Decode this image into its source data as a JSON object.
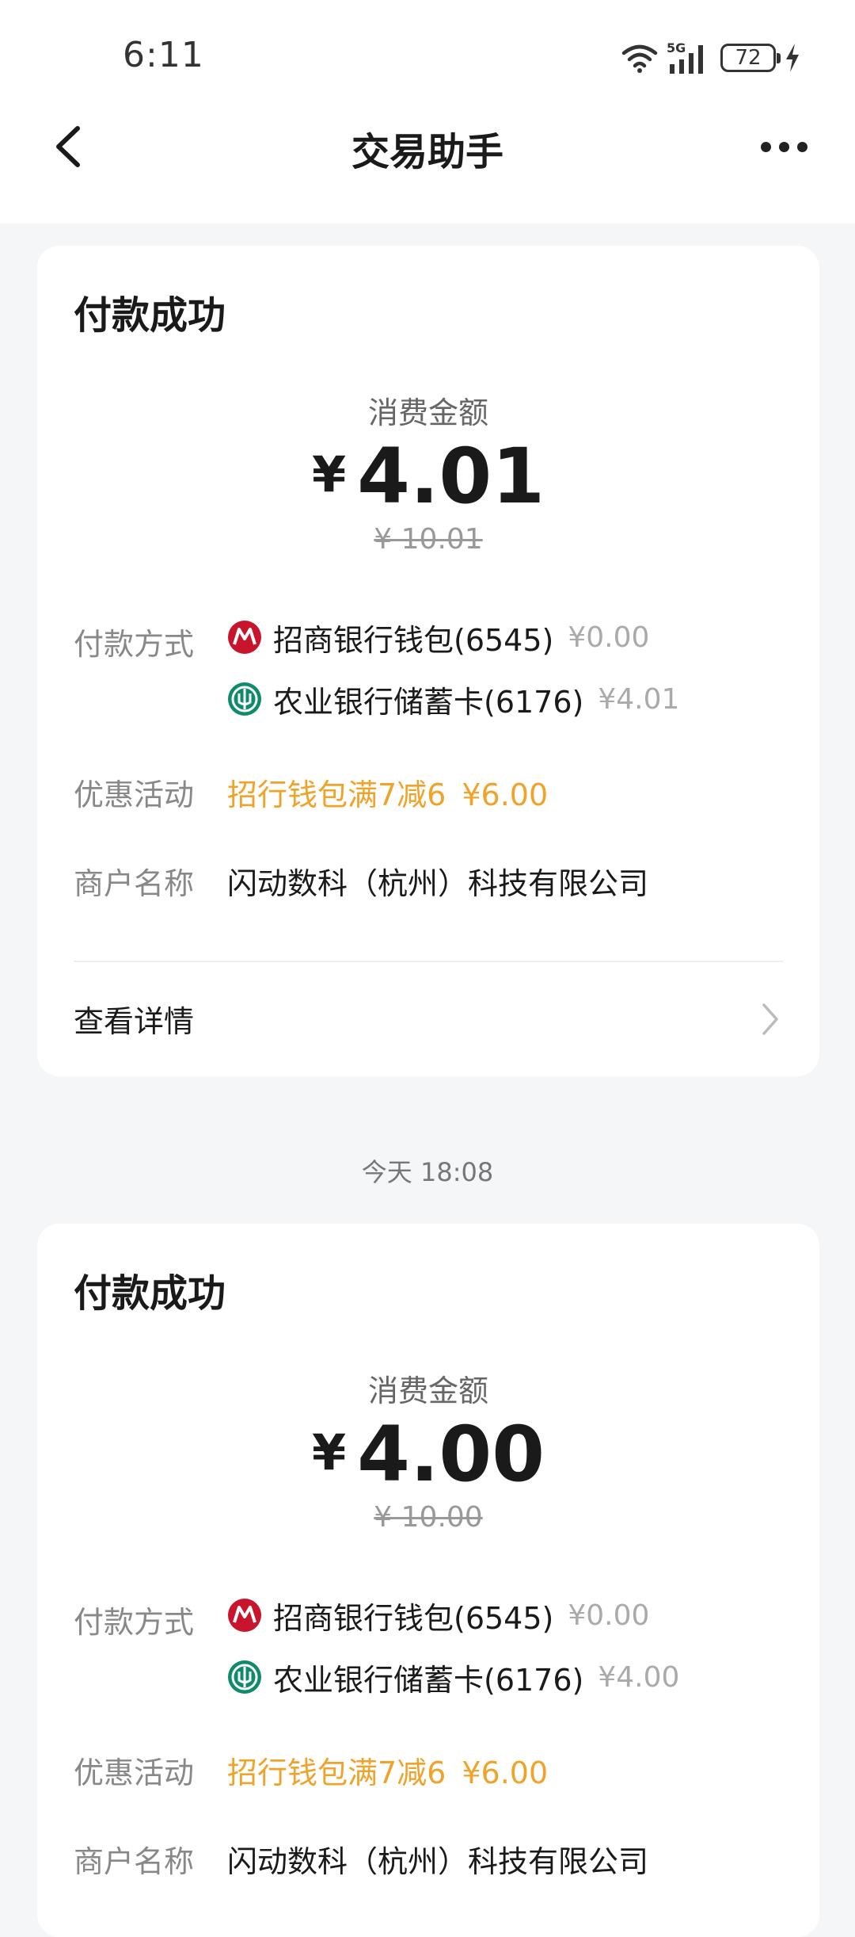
{
  "status_bar": {
    "time": "6:11",
    "network": "5G",
    "battery": "72"
  },
  "header": {
    "title": "交易助手"
  },
  "transactions": [
    {
      "status": "付款成功",
      "amount_label": "消费金额",
      "currency": "¥",
      "amount": "4.01",
      "original_amount": "¥ 10.01",
      "payment_label": "付款方式",
      "payments": [
        {
          "bank": "招商银行钱包(6545)",
          "amount": "¥0.00",
          "icon": "cmb-bank-icon",
          "color": "#c8152d"
        },
        {
          "bank": "农业银行储蓄卡(6176)",
          "amount": "¥4.01",
          "icon": "abc-bank-icon",
          "color": "#0f8a6a"
        }
      ],
      "promo_label": "优惠活动",
      "promo_text": "招行钱包满7减6",
      "promo_amount": "¥6.00",
      "merchant_label": "商户名称",
      "merchant": "闪动数科（杭州）科技有限公司",
      "details_label": "查看详情"
    },
    {
      "status": "付款成功",
      "amount_label": "消费金额",
      "currency": "¥",
      "amount": "4.00",
      "original_amount": "¥ 10.00",
      "payment_label": "付款方式",
      "payments": [
        {
          "bank": "招商银行钱包(6545)",
          "amount": "¥0.00",
          "icon": "cmb-bank-icon",
          "color": "#c8152d"
        },
        {
          "bank": "农业银行储蓄卡(6176)",
          "amount": "¥4.00",
          "icon": "abc-bank-icon",
          "color": "#0f8a6a"
        }
      ],
      "promo_label": "优惠活动",
      "promo_text": "招行钱包满7减6",
      "promo_amount": "¥6.00",
      "merchant_label": "商户名称",
      "merchant": "闪动数科（杭州）科技有限公司"
    }
  ],
  "timestamp": "今天 18:08",
  "colors": {
    "promo": "#f0a32a",
    "background": "#f5f6f8",
    "card": "#ffffff"
  }
}
